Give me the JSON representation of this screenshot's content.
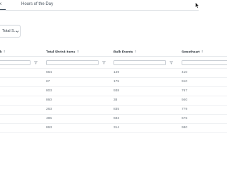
{
  "tabs": [
    {
      "label": "k",
      "active": true
    },
    {
      "label": "Hours of the Day",
      "active": false
    }
  ],
  "dropdown": {
    "value": "Total S..."
  },
  "table": {
    "columns": [
      {
        "label": "k"
      },
      {
        "label": "Total Shrink Items"
      },
      {
        "label": "Bulk Events"
      },
      {
        "label": "Sweetheart"
      }
    ],
    "sort_icon": "⇕",
    "rows": [
      [
        "",
        "664",
        "149",
        "410"
      ],
      [
        "",
        "67",
        "175",
        "910"
      ],
      [
        "",
        "803",
        "938",
        "767"
      ],
      [
        "",
        "860",
        "38",
        "940"
      ],
      [
        "",
        "263",
        "835",
        "779"
      ],
      [
        "",
        "485",
        "683",
        "675"
      ],
      [
        "",
        "863",
        "314",
        "980"
      ]
    ]
  },
  "icons": {
    "filter": "filter-icon",
    "sort": "sort-icon",
    "chevron": "chevron-down-icon",
    "cursor": "cursor-icon"
  },
  "colors": {
    "header_text": "#2b333b",
    "cell_text": "#6b747d",
    "border": "#c9ced4",
    "filter_icon": "#7b8691"
  }
}
